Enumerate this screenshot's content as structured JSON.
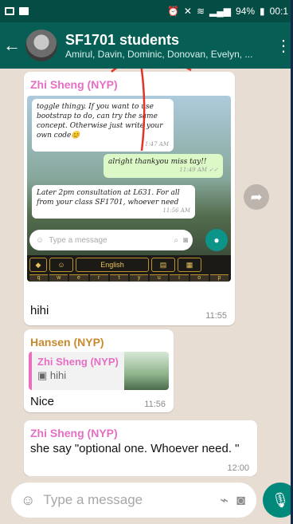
{
  "status_bar": {
    "battery": "94%",
    "time": "00:1"
  },
  "header": {
    "title": "SF1701 students",
    "subtitle": "Amirul, Davin, Dominic, Donovan, Evelyn, ..."
  },
  "messages": [
    {
      "sender": "Zhi Sheng (NYP)",
      "sender_color": "#e46fc4",
      "screenshot": {
        "bubble1_text": "toggle thingy. If you want to use bootstrap to do, can try the same concept. Otherwise just write your own code😊",
        "bubble1_time": "11:47 AM",
        "bubble2_text": "alright thankyou miss tay!!",
        "bubble2_time": "11:49 AM ✓✓",
        "bubble3_text": "Later 2pm consultation at L631. For all from your class SF1701, whoever need",
        "bubble3_time": "11:56 AM",
        "input_placeholder": "Type a message",
        "keyboard_language": "English",
        "keyboard_keys": [
          "q",
          "w",
          "e",
          "r",
          "t",
          "y",
          "u",
          "i",
          "o",
          "p"
        ]
      },
      "text": "hihi",
      "time": "11:55"
    },
    {
      "sender": "Hansen (NYP)",
      "sender_color": "#c88a2e",
      "quote": {
        "sender": "Zhi Sheng (NYP)",
        "text": "hihi"
      },
      "text": "Nice",
      "time": "11:56"
    },
    {
      "sender": "Zhi Sheng (NYP)",
      "sender_color": "#e46fc4",
      "text": "she say \"optional one. Whoever need. \"",
      "time": "12:00"
    }
  ],
  "input": {
    "placeholder": "Type a message"
  },
  "colors": {
    "header_bg": "#075e54",
    "status_bg": "#054d44",
    "chat_bg": "#e7ddd3",
    "mic_bg": "#00897b",
    "annotation_red": "#e0342a"
  }
}
